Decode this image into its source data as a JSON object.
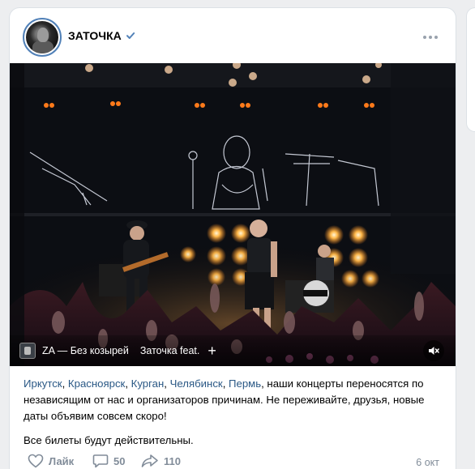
{
  "post": {
    "author": "ЗАТОЧКА",
    "verified": true,
    "date": "6 окт",
    "audio": {
      "title": "ZA — Без козырей",
      "next": "Заточка feat.",
      "add_label": "+"
    },
    "text": {
      "cities": [
        "Иркутск",
        "Красноярск",
        "Курган",
        "Челябинск",
        "Пермь"
      ],
      "sep": ", ",
      "rest": ", наши концерты переносятся по независящим от нас и организаторов причинам. Не переживайте, друзья, новые даты объявим совсем скоро!",
      "p2": "Все билеты будут действительны."
    },
    "actions": {
      "like_label": "Лайк",
      "comments": "50",
      "shares": "110"
    }
  },
  "colors": {
    "link": "#2a5885",
    "accent": "#5181b8",
    "muted": "#818c99"
  }
}
